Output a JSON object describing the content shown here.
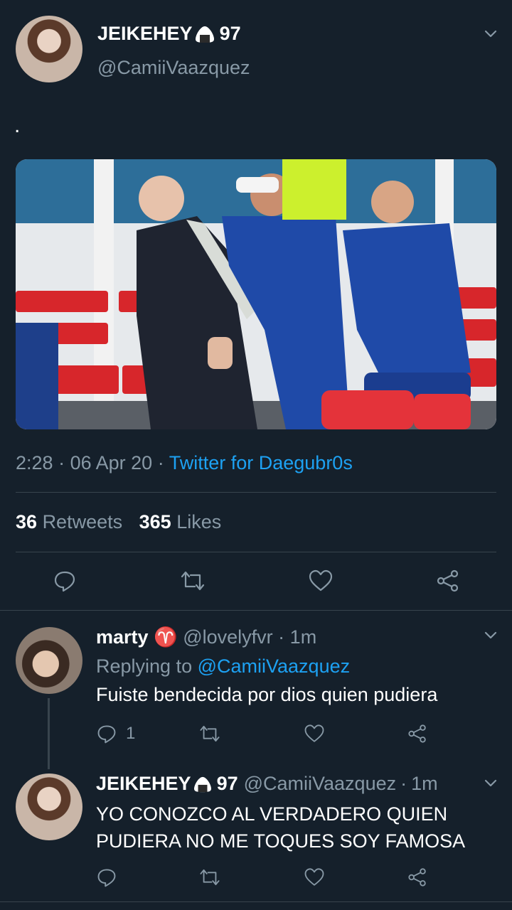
{
  "main_tweet": {
    "display_name": "JEIKEHEY",
    "name_suffix": "97",
    "handle": "@CamiiVaazquez",
    "text": ".",
    "time": "2:28",
    "date": "06 Apr 20",
    "source": "Twitter for Daegubr0s",
    "retweets_count": "36",
    "retweets_label": "Retweets",
    "likes_count": "365",
    "likes_label": "Likes",
    "sep": "·"
  },
  "replies": [
    {
      "display_name": "marty",
      "emoji": "♈",
      "handle": "@lovelyfvr",
      "time": "1m",
      "replying_prefix": "Replying to",
      "replying_to": "@CamiiVaazquez",
      "text": "Fuiste bendecida por dios quien pudiera",
      "reply_count": "1"
    },
    {
      "display_name": "JEIKEHEY",
      "name_suffix": "97",
      "handle": "@CamiiVaazquez",
      "time": "1m",
      "text_line1": "YO CONOZCO AL VERDADERO QUIEN",
      "text_line2": "PUDIERA NO ME TOQUES SOY FAMOSA"
    }
  ],
  "icons": {
    "reply": "reply-icon",
    "retweet": "retweet-icon",
    "like": "heart-icon",
    "share": "share-icon",
    "more": "chevron-down-icon",
    "onigiri": "rice-ball-emoji"
  },
  "colors": {
    "background": "#15202b",
    "muted": "#8899a6",
    "link": "#1da1f2",
    "divider": "#38444d"
  }
}
